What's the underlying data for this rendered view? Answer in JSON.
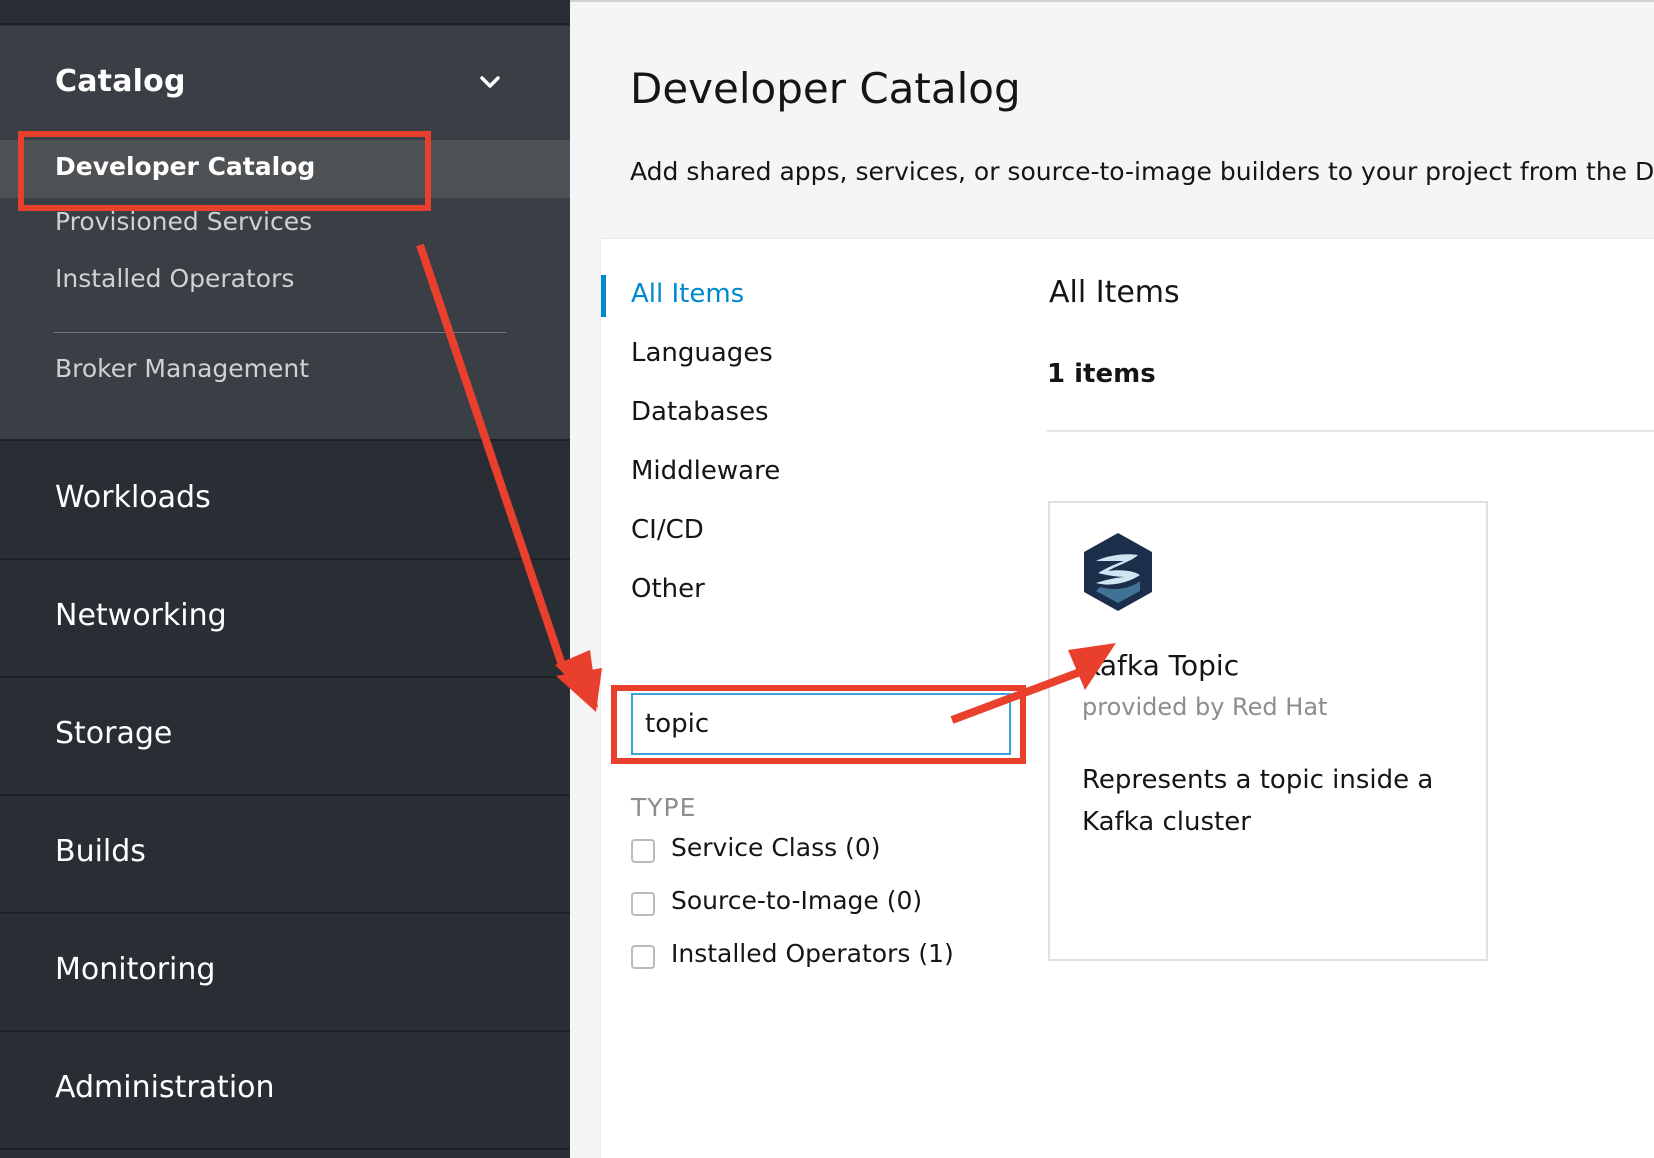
{
  "sidebar": {
    "catalog": {
      "title": "Catalog",
      "items": [
        {
          "label": "Developer Catalog",
          "active": true
        },
        {
          "label": "Provisioned Services",
          "active": false
        },
        {
          "label": "Installed Operators",
          "active": false
        },
        {
          "label": "Broker Management",
          "active": false
        }
      ]
    },
    "sections": [
      {
        "label": "Workloads"
      },
      {
        "label": "Networking"
      },
      {
        "label": "Storage"
      },
      {
        "label": "Builds"
      },
      {
        "label": "Monitoring"
      },
      {
        "label": "Administration"
      }
    ]
  },
  "main": {
    "title": "Developer Catalog",
    "description": "Add shared apps, services, or source-to-image builders to your project from the Dev",
    "categories": [
      {
        "label": "All Items",
        "state": "active"
      },
      {
        "label": "Languages",
        "state": "normal"
      },
      {
        "label": "Databases",
        "state": "normal"
      },
      {
        "label": "Middleware",
        "state": "normal"
      },
      {
        "label": "CI/CD",
        "state": "normal"
      },
      {
        "label": "Other",
        "state": "emphasis"
      }
    ],
    "search": {
      "value": "topic"
    },
    "filters": {
      "heading": "TYPE",
      "items": [
        {
          "label": "Service Class (0)",
          "checked": false
        },
        {
          "label": "Source-to-Image (0)",
          "checked": false
        },
        {
          "label": "Installed Operators (1)",
          "checked": false
        }
      ]
    },
    "results": {
      "title": "All Items",
      "count": "1 items",
      "tiles": [
        {
          "icon": "kafka-strimzi-icon",
          "title": "Kafka Topic",
          "provider": "provided by Red Hat",
          "description": "Represents a topic inside a Kafka cluster"
        }
      ]
    }
  },
  "colors": {
    "annotation": "#e8402c",
    "accent": "#0088ce",
    "sidebar_bg": "#292e34",
    "sidebar_open_bg": "#393f44"
  }
}
